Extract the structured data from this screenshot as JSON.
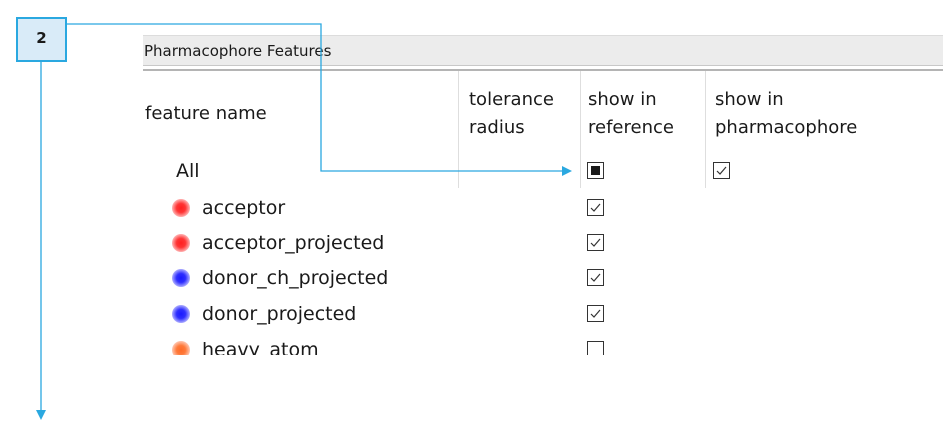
{
  "step_badge": {
    "number": "2"
  },
  "panel": {
    "title": "Pharmacophore Features"
  },
  "columns": {
    "feature_name": "feature name",
    "tolerance_radius_line1": "tolerance",
    "tolerance_radius_line2": "radius",
    "show_in_reference_line1": "show in",
    "show_in_reference_line2": "reference",
    "show_in_pharmacophore_line1": "show in",
    "show_in_pharmacophore_line2": "pharmacophore"
  },
  "rows": [
    {
      "label": "All",
      "color": "",
      "show_in_reference": "partial",
      "show_in_pharmacophore": "checked"
    },
    {
      "label": "acceptor",
      "color": "red",
      "show_in_reference": "checked",
      "show_in_pharmacophore": "none"
    },
    {
      "label": "acceptor_projected",
      "color": "red",
      "show_in_reference": "checked",
      "show_in_pharmacophore": "none"
    },
    {
      "label": "donor_ch_projected",
      "color": "blue",
      "show_in_reference": "checked",
      "show_in_pharmacophore": "none"
    },
    {
      "label": "donor_projected",
      "color": "blue",
      "show_in_reference": "checked",
      "show_in_pharmacophore": "none"
    },
    {
      "label": "heavy_atom",
      "color": "orange",
      "show_in_reference": "unchecked",
      "show_in_pharmacophore": "none"
    }
  ],
  "colors": {
    "annotation_arrow": "#2aa8e0",
    "feature_red": "#ff2020",
    "feature_blue": "#1a1aff",
    "feature_orange": "#ff6a28"
  }
}
